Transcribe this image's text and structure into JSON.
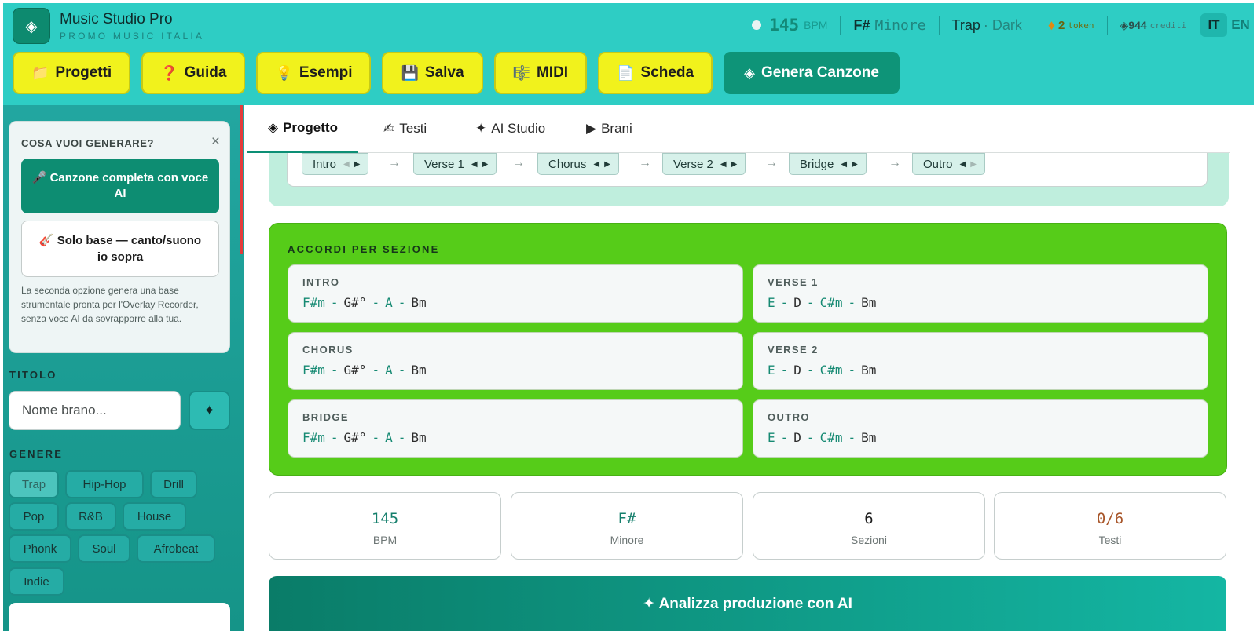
{
  "app": {
    "logo_icon": "diamond-icon",
    "title": "Music Studio Pro",
    "subtitle": "PROMO MUSIC ITALIA"
  },
  "status": {
    "bpm": "145",
    "bpm_unit": "BPM",
    "key": "F#",
    "mode": "Minore",
    "genre": "Trap",
    "mood": "· Dark",
    "tokens": "2",
    "tokens_unit": "token",
    "credits": "◈944",
    "credits_unit": "crediti",
    "languages": [
      "IT",
      "EN"
    ],
    "active_language": "IT"
  },
  "toolbar": [
    {
      "icon": "📁",
      "label": "Progetti"
    },
    {
      "icon": "❓",
      "label": "Guida"
    },
    {
      "icon": "💡",
      "label": "Esempi"
    },
    {
      "icon": "💾",
      "label": "Salva"
    },
    {
      "icon": "🎼",
      "label": "MIDI"
    },
    {
      "icon": "📄",
      "label": "Scheda"
    },
    {
      "icon": "◈",
      "label": "Genera Canzone"
    }
  ],
  "sidebar": {
    "gen_title": "COSA VUOI GENERARE?",
    "close": "×",
    "option_full": "🎤 Canzone completa con voce AI",
    "option_base": "🎸 Solo base — canto/suono io sopra",
    "note": "La seconda opzione genera una base strumentale pronta per l'Overlay Recorder, senza voce AI da sovrapporre alla tua.",
    "title_label": "TITOLO",
    "title_placeholder": "Nome brano...",
    "title_generate": "✦",
    "genre_label": "GENERE",
    "genres": [
      "Trap",
      "Hip-Hop",
      "Drill",
      "Pop",
      "R&B",
      "House",
      "Phonk",
      "Soul",
      "Afrobeat",
      "Indie"
    ],
    "active_genre": "Trap"
  },
  "tabs": [
    {
      "icon": "◈",
      "label": "Progetto"
    },
    {
      "icon": "✍",
      "label": "Testi"
    },
    {
      "icon": "✦",
      "label": "AI Studio"
    },
    {
      "icon": "▶",
      "label": "Brani"
    }
  ],
  "structure": {
    "sections": [
      "Intro",
      "Verse 1",
      "Chorus",
      "Verse 2",
      "Bridge",
      "Outro"
    ],
    "arrow_left": "◀",
    "arrow_right": "▶",
    "flow_arrow": "→"
  },
  "chords": {
    "title": "ACCORDI PER SEZIONE",
    "sections": [
      {
        "name": "INTRO",
        "chords": [
          "F#m",
          "G#°",
          "A",
          "Bm"
        ]
      },
      {
        "name": "VERSE 1",
        "chords": [
          "E",
          "D",
          "C#m",
          "Bm"
        ]
      },
      {
        "name": "CHORUS",
        "chords": [
          "F#m",
          "G#°",
          "A",
          "Bm"
        ]
      },
      {
        "name": "VERSE 2",
        "chords": [
          "E",
          "D",
          "C#m",
          "Bm"
        ]
      },
      {
        "name": "BRIDGE",
        "chords": [
          "F#m",
          "G#°",
          "A",
          "Bm"
        ]
      },
      {
        "name": "OUTRO",
        "chords": [
          "E",
          "D",
          "C#m",
          "Bm"
        ]
      }
    ]
  },
  "stats": [
    {
      "value": "145",
      "label": "BPM",
      "color": "#157f6c"
    },
    {
      "value": "F#",
      "label": "Minore",
      "color": "#157f6c"
    },
    {
      "value": "6",
      "label": "Sezioni",
      "color": "#1c1c1c"
    },
    {
      "value": "0/6",
      "label": "Testi",
      "color": "#a8562a"
    }
  ],
  "analyze_label": "✦ Analizza produzione con AI"
}
